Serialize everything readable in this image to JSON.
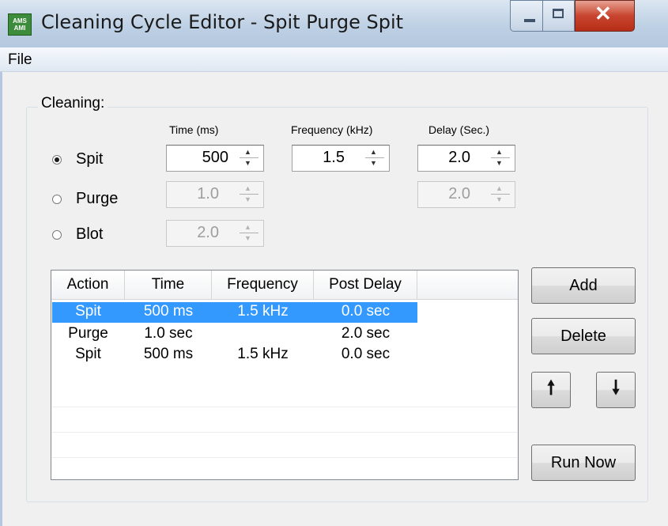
{
  "window": {
    "app_icon_text": "AMS AMI",
    "title": "Cleaning Cycle Editor - Spit Purge Spit",
    "controls": {
      "minimize_icon": "minimize-icon",
      "maximize_icon": "maximize-icon",
      "close_icon": "close-icon"
    }
  },
  "menu": {
    "items": [
      {
        "label": "File"
      }
    ]
  },
  "cleaning": {
    "group_label": "Cleaning:",
    "headers": {
      "time": "Time (ms)",
      "frequency": "Frequency (kHz)",
      "delay": "Delay (Sec.)"
    },
    "selected_action": "Spit",
    "rows": [
      {
        "label": "Spit",
        "selected": true,
        "time": "500",
        "frequency": "1.5",
        "delay": "2.0"
      },
      {
        "label": "Purge",
        "selected": false,
        "time": "1.0",
        "delay": "2.0"
      },
      {
        "label": "Blot",
        "selected": false,
        "time": "2.0"
      }
    ]
  },
  "list": {
    "columns": [
      "Action",
      "Time",
      "Frequency",
      "Post Delay"
    ],
    "rows": [
      {
        "action": "Spit",
        "time": "500 ms",
        "frequency": "1.5 kHz",
        "post_delay": "0.0 sec",
        "selected": true
      },
      {
        "action": "Purge",
        "time": "1.0 sec",
        "frequency": "",
        "post_delay": "2.0 sec",
        "selected": false
      },
      {
        "action": "Spit",
        "time": "500 ms",
        "frequency": "1.5 kHz",
        "post_delay": "0.0 sec",
        "selected": false
      }
    ],
    "selection_color": "#3399ff"
  },
  "buttons": {
    "add": "Add",
    "delete": "Delete",
    "move_up_icon": "arrow-up-icon",
    "move_down_icon": "arrow-down-icon",
    "run_now": "Run Now"
  },
  "colors": {
    "titlebar": "#bed0e4",
    "close_button": "#c8452f",
    "client_bg": "#f0f0f0"
  }
}
